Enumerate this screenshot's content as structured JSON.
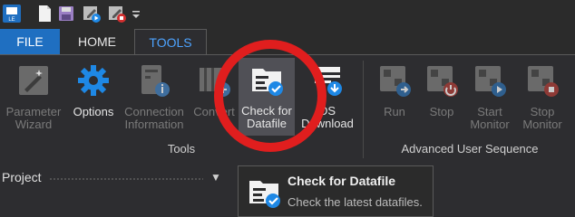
{
  "tabs": {
    "file": "FILE",
    "home": "HOME",
    "tools": "TOOLS"
  },
  "ribbon": {
    "buttons": [
      {
        "label": "Parameter Wizard",
        "line1": "Parameter",
        "line2": "Wizard",
        "icon": "wand-icon",
        "enabled": false
      },
      {
        "label": "Options",
        "line1": "Options",
        "line2": "",
        "icon": "gear-icon",
        "enabled": true
      },
      {
        "label": "Connection Information",
        "line1": "Connection",
        "line2": "Information",
        "icon": "connection-info-icon",
        "enabled": false
      },
      {
        "label": "Convert",
        "line1": "Convert",
        "line2": "",
        "icon": "convert-icon",
        "enabled": false
      },
      {
        "label": "Check for Datafile",
        "line1": "Check for",
        "line2": "Datafile",
        "icon": "check-datafile-icon",
        "enabled": true
      },
      {
        "label": "DS Download",
        "line1": "DS",
        "line2": "Download",
        "icon": "download-icon",
        "enabled": true
      },
      {
        "label": "Run",
        "line1": "Run",
        "line2": "",
        "icon": "run-icon",
        "enabled": false
      },
      {
        "label": "Stop",
        "line1": "Stop",
        "line2": "",
        "icon": "stop-icon",
        "enabled": false
      },
      {
        "label": "Start Monitor",
        "line1": "Start",
        "line2": "Monitor",
        "icon": "start-monitor-icon",
        "enabled": false
      },
      {
        "label": "Stop Monitor",
        "line1": "Stop",
        "line2": "Monitor",
        "icon": "stop-monitor-icon",
        "enabled": false
      }
    ],
    "groups": {
      "tools": "Tools",
      "sequence": "Advanced User Sequence"
    }
  },
  "panel": {
    "title": "Project"
  },
  "tooltip": {
    "title": "Check for Datafile",
    "description": "Check the latest datafiles."
  },
  "colors": {
    "accent": "#1f6fc1",
    "tab_active_text": "#4da3ff",
    "annotation": "#e01e1e",
    "icon_blue": "#1e88e5"
  }
}
